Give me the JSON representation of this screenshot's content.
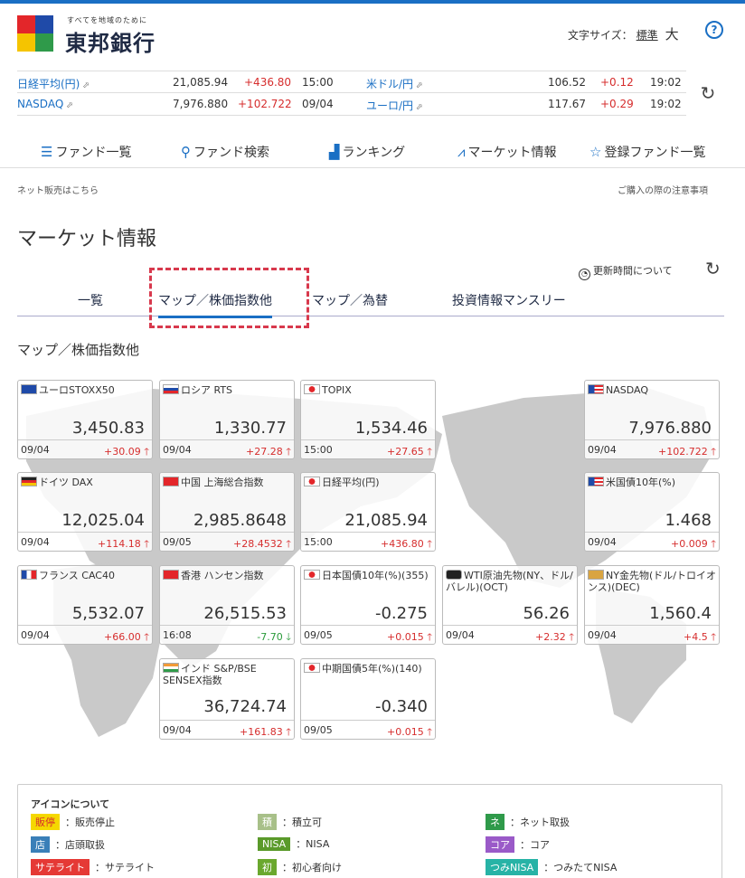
{
  "header": {
    "bank_tagline": "すべてを地域のために",
    "bank_name": "東邦銀行",
    "font_size_label": "文字サイズ：",
    "font_size_standard": "標準",
    "font_size_large": "大",
    "help_label": "?"
  },
  "ticker": [
    {
      "name": "日経平均(円)",
      "value": "21,085.94",
      "change": "+436.80",
      "time": "15:00"
    },
    {
      "name": "NASDAQ",
      "value": "7,976.880",
      "change": "+102.722",
      "time": "09/04"
    },
    {
      "name": "米ドル/円",
      "value": "106.52",
      "change": "+0.12",
      "time": "19:02"
    },
    {
      "name": "ユーロ/円",
      "value": "117.67",
      "change": "+0.29",
      "time": "19:02"
    }
  ],
  "nav": [
    {
      "icon": "list-icon",
      "label": "ファンド一覧"
    },
    {
      "icon": "search-icon",
      "label": "ファンド検索"
    },
    {
      "icon": "ranking-icon",
      "label": "ランキング"
    },
    {
      "icon": "chart-icon",
      "label": "マーケット情報"
    },
    {
      "icon": "star-icon",
      "label": "登録ファンド一覧"
    }
  ],
  "links": {
    "net_sales": "ネット販売はこちら",
    "purchase_notes": "ご購入の際の注意事項",
    "update_time": "更新時間について"
  },
  "page_title": "マーケット情報",
  "tabs": [
    "一覧",
    "マップ／株価指数他",
    "マップ／為替",
    "投資情報マンスリー"
  ],
  "section_title": "マップ／株価指数他",
  "tiles": [
    {
      "name": "ユーロSTOXX50",
      "value": "3,450.83",
      "date": "09/04",
      "delta": "+30.09",
      "dir": "up"
    },
    {
      "name": "ロシア RTS",
      "value": "1,330.77",
      "date": "09/04",
      "delta": "+27.28",
      "dir": "up"
    },
    {
      "name": "TOPIX",
      "value": "1,534.46",
      "date": "15:00",
      "delta": "+27.65",
      "dir": "up"
    },
    {
      "name": "NASDAQ",
      "value": "7,976.880",
      "date": "09/04",
      "delta": "+102.722",
      "dir": "up"
    },
    {
      "name": "ドイツ DAX",
      "value": "12,025.04",
      "date": "09/04",
      "delta": "+114.18",
      "dir": "up"
    },
    {
      "name": "中国 上海総合指数",
      "value": "2,985.8648",
      "date": "09/05",
      "delta": "+28.4532",
      "dir": "up"
    },
    {
      "name": "日経平均(円)",
      "value": "21,085.94",
      "date": "15:00",
      "delta": "+436.80",
      "dir": "up"
    },
    {
      "name": "米国債10年(%)",
      "value": "1.468",
      "date": "09/04",
      "delta": "+0.009",
      "dir": "up"
    },
    {
      "name": "フランス CAC40",
      "value": "5,532.07",
      "date": "09/04",
      "delta": "+66.00",
      "dir": "up"
    },
    {
      "name": "香港 ハンセン指数",
      "value": "26,515.53",
      "date": "16:08",
      "delta": "-7.70",
      "dir": "down"
    },
    {
      "name": "日本国債10年(%)(355)",
      "value": "-0.275",
      "date": "09/05",
      "delta": "+0.015",
      "dir": "up"
    },
    {
      "name": "WTI原油先物(NY、ドル/バレル)(OCT)",
      "value": "56.26",
      "date": "09/04",
      "delta": "+2.32",
      "dir": "up"
    },
    {
      "name": "NY金先物(ドル/トロイオンス)(DEC)",
      "value": "1,560.4",
      "date": "09/04",
      "delta": "+4.5",
      "dir": "up"
    },
    {
      "name": "インド S&P/BSE SENSEX指数",
      "value": "36,724.74",
      "date": "09/04",
      "delta": "+161.83",
      "dir": "up"
    },
    {
      "name": "中期国債5年(%)(140)",
      "value": "-0.340",
      "date": "09/05",
      "delta": "+0.015",
      "dir": "up"
    }
  ],
  "legend": {
    "title": "アイコンについて",
    "items": [
      {
        "badge": "販停",
        "color": "#f5d800",
        "text_color": "#d62d2d",
        "desc": "：販売停止"
      },
      {
        "badge": "積",
        "color": "#a8c089",
        "text_color": "#ffffff",
        "desc": "：積立可"
      },
      {
        "badge": "ネ",
        "color": "#2f9a4a",
        "text_color": "#ffffff",
        "desc": "：ネット取扱"
      },
      {
        "badge": "店",
        "color": "#3a7fb8",
        "text_color": "#ffffff",
        "desc": "：店頭取扱"
      },
      {
        "badge": "NISA",
        "color": "#5a9a2a",
        "text_color": "#ffffff",
        "desc": "：NISA"
      },
      {
        "badge": "コア",
        "color": "#9a5ac8",
        "text_color": "#ffffff",
        "desc": "：コア"
      },
      {
        "badge": "サテライト",
        "color": "#e53935",
        "text_color": "#ffffff",
        "desc": "：サテライト"
      },
      {
        "badge": "初",
        "color": "#6aa82e",
        "text_color": "#ffffff",
        "desc": "：初心者向け"
      },
      {
        "badge": "つみNISA",
        "color": "#27b3a6",
        "text_color": "#ffffff",
        "desc": "：つみたてNISA"
      }
    ]
  },
  "colors": {
    "accent": "#1a6fc4",
    "up": "#d62d2d",
    "down": "#2a9a3a",
    "highlight": "#d8394d"
  }
}
